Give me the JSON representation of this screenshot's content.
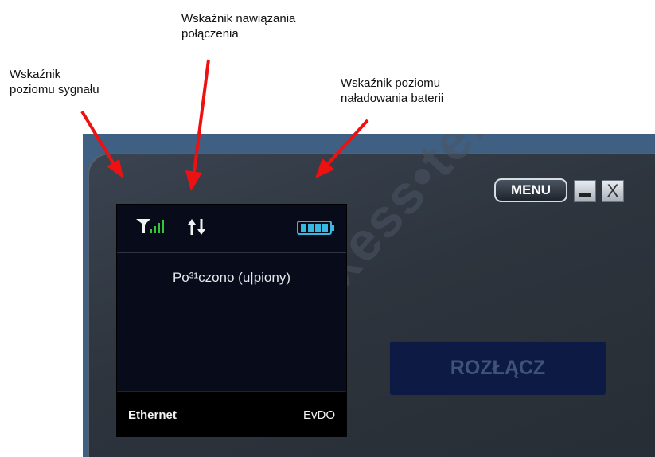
{
  "callouts": {
    "signal": "Wskaźnik\npoziomu sygnału",
    "connection": "Wskaźnik nawiązania\npołączenia",
    "battery": "Wskaźnik poziomu\nnaładowania baterii"
  },
  "window": {
    "menu_label": "MENU",
    "close_label": "X",
    "watermark": "axess•tel",
    "disconnect_label": "ROZŁĄCZ"
  },
  "screen": {
    "status": "Po³¹czono (u|piony)",
    "network_left": "Ethernet",
    "network_right": "EvDO"
  },
  "colors": {
    "arrow": "#ee1111",
    "signal_bars": "#35c43a",
    "battery": "#38b8e0",
    "disconnect_bg": "#0d1a44"
  },
  "icons": {
    "signal": "signal-strength-icon",
    "connection": "connection-arrows-icon",
    "battery": "battery-icon"
  }
}
